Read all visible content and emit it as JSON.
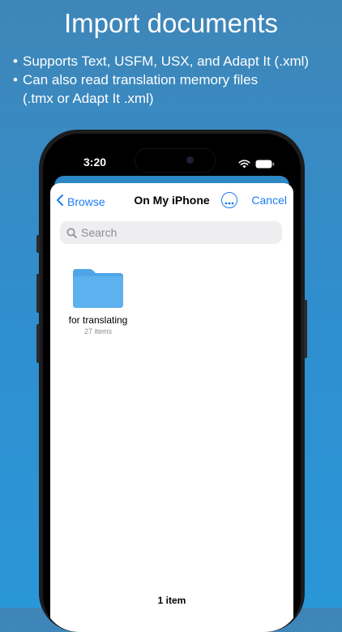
{
  "promo": {
    "headline": "Import documents",
    "bullets": [
      "Supports Text,  USFM, USX, and Adapt It (.xml)",
      "Can also read translation memory files"
    ],
    "bullet_continuation": "(.tmx or Adapt It .xml)"
  },
  "status_bar": {
    "time": "3:20"
  },
  "nav": {
    "back_label": "Browse",
    "title": "On My iPhone",
    "cancel_label": "Cancel"
  },
  "search": {
    "placeholder": "Search"
  },
  "folders": [
    {
      "name": "for translating",
      "count": "27 items"
    }
  ],
  "footer": {
    "item_count": "1 item"
  },
  "colors": {
    "accent": "#1a7cf4",
    "folder": "#5db1ee",
    "background": "#2f8fcf"
  },
  "icons": [
    "chevron-left-icon",
    "ellipsis-circle-icon",
    "search-icon",
    "folder-icon",
    "wifi-icon",
    "battery-icon"
  ]
}
